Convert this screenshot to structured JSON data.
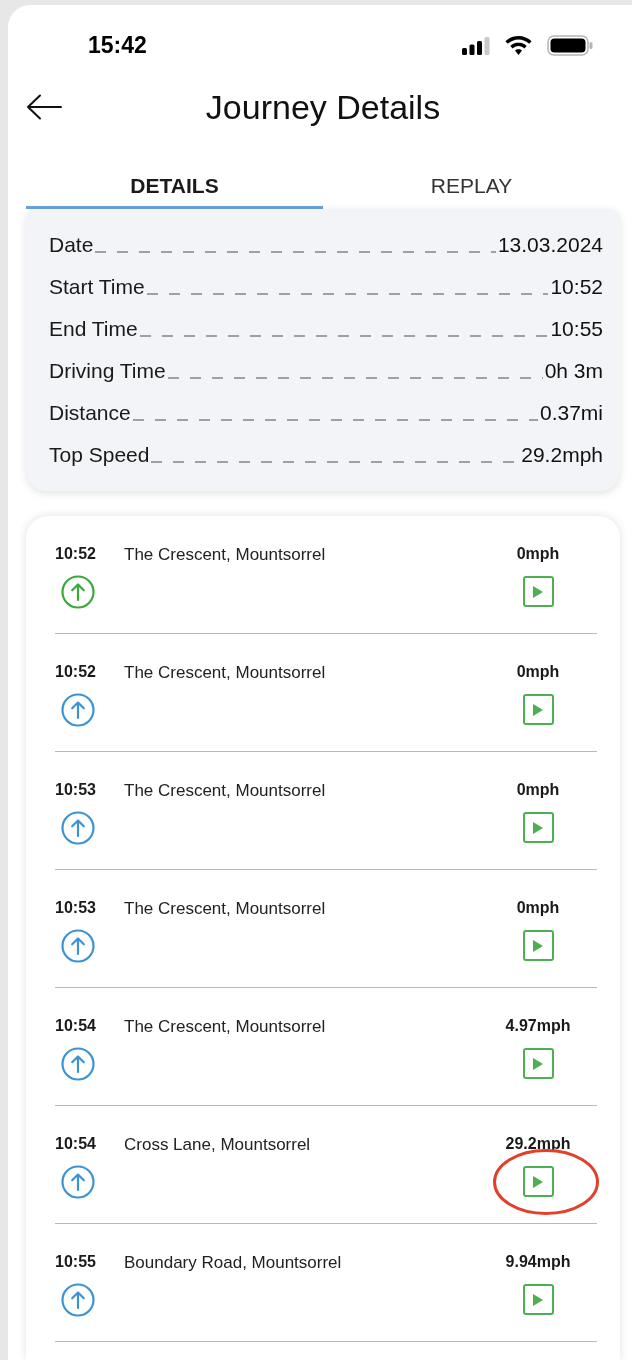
{
  "status_bar": {
    "time": "15:42"
  },
  "header": {
    "title": "Journey Details"
  },
  "tabs": [
    {
      "label": "DETAILS",
      "selected": true
    },
    {
      "label": "REPLAY",
      "selected": false
    }
  ],
  "summary": [
    {
      "label": "Date",
      "value": "13.03.2024"
    },
    {
      "label": "Start Time",
      "value": "10:52"
    },
    {
      "label": "End Time",
      "value": "10:55"
    },
    {
      "label": "Driving Time",
      "value": "0h 3m"
    },
    {
      "label": "Distance",
      "value": "0.37mi"
    },
    {
      "label": "Top Speed",
      "value": "29.2mph"
    }
  ],
  "events": [
    {
      "time": "10:52",
      "address": "The Crescent, Mountsorrel",
      "speed": "0mph",
      "color": "#3aa83a",
      "highlighted": false
    },
    {
      "time": "10:52",
      "address": "The Crescent, Mountsorrel",
      "speed": "0mph",
      "color": "#3b93d4",
      "highlighted": false
    },
    {
      "time": "10:53",
      "address": "The Crescent, Mountsorrel",
      "speed": "0mph",
      "color": "#3b93d4",
      "highlighted": false
    },
    {
      "time": "10:53",
      "address": "The Crescent, Mountsorrel",
      "speed": "0mph",
      "color": "#3b93d4",
      "highlighted": false
    },
    {
      "time": "10:54",
      "address": "The Crescent, Mountsorrel",
      "speed": "4.97mph",
      "color": "#3b93d4",
      "highlighted": false
    },
    {
      "time": "10:54",
      "address": "Cross Lane, Mountsorrel",
      "speed": "29.2mph",
      "color": "#3b93d4",
      "highlighted": true
    },
    {
      "time": "10:55",
      "address": "Boundary Road, Mountsorrel",
      "speed": "9.94mph",
      "color": "#3b93d4",
      "highlighted": false
    }
  ]
}
